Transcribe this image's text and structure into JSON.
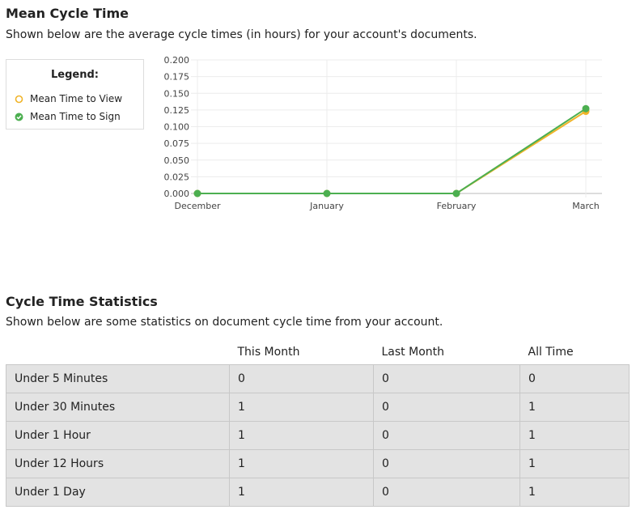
{
  "mean_cycle": {
    "title": "Mean Cycle Time",
    "description": "Shown below are the average cycle times (in hours) for your account's documents.",
    "legend": {
      "title": "Legend:",
      "items": [
        {
          "label": "Mean Time to View",
          "color": "#f0b429",
          "icon": "circle-outline-icon"
        },
        {
          "label": "Mean Time to Sign",
          "color": "#4caf50",
          "icon": "check-circle-icon"
        }
      ]
    }
  },
  "chart_data": {
    "type": "line",
    "categories": [
      "December",
      "January",
      "February",
      "March"
    ],
    "series": [
      {
        "name": "Mean Time to View",
        "color": "#f0b429",
        "values": [
          0,
          0,
          0,
          0.123
        ]
      },
      {
        "name": "Mean Time to Sign",
        "color": "#4caf50",
        "values": [
          0,
          0,
          0,
          0.127
        ]
      }
    ],
    "yticks": [
      "0.000",
      "0.025",
      "0.050",
      "0.075",
      "0.100",
      "0.125",
      "0.150",
      "0.175",
      "0.200"
    ],
    "ylim": [
      0,
      0.2
    ],
    "grid": true
  },
  "stats": {
    "title": "Cycle Time Statistics",
    "description": "Shown below are some statistics on document cycle time from your account.",
    "headers": [
      "",
      "This Month",
      "Last Month",
      "All Time"
    ],
    "rows": [
      [
        "Under 5 Minutes",
        "0",
        "0",
        "0"
      ],
      [
        "Under 30 Minutes",
        "1",
        "0",
        "1"
      ],
      [
        "Under 1 Hour",
        "1",
        "0",
        "1"
      ],
      [
        "Under 12 Hours",
        "1",
        "0",
        "1"
      ],
      [
        "Under 1 Day",
        "1",
        "0",
        "1"
      ]
    ]
  }
}
